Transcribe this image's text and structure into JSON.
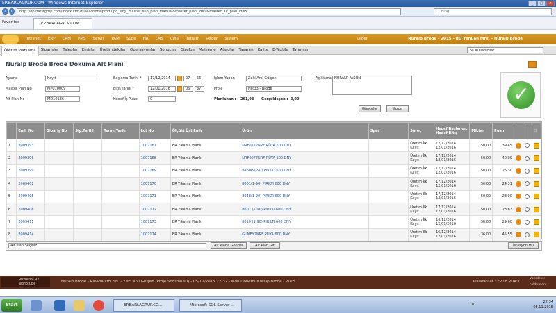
{
  "window": {
    "title": "EP.BARLAGRUP.COM - Windows Internet Explorer",
    "tab": "EP.BARLAGRUP.COM",
    "favorites": "Favorites"
  },
  "address": {
    "url": "http://ep.barlagrup.com/index.cfm?fuseaction=prod.upd_ezgi_master_sub_plan_manual&master_plan_id=9&master_alt_plan_id=5...",
    "search": "Bing"
  },
  "topmenu": {
    "items": [
      "Intranet",
      "ERP",
      "CRM",
      "PMS",
      "Servis",
      "PAM",
      "Şube",
      "HR",
      "LMS",
      "CMS",
      "İletişim",
      "Rapor",
      "Sistem"
    ],
    "other": "Diğer",
    "user": "Nuralp Brode - 2015 - BG Yenuan Mrk. - Nuralp Brode"
  },
  "submenu": {
    "items": [
      "Üretim Planlama",
      "Siparişler",
      "Talepler",
      "Emirler",
      "Üretimdekiler",
      "Operasyonlar",
      "Sonuçlar",
      "Çizelge",
      "Malzeme",
      "Ağaçlar",
      "Tasarım",
      "Kalite",
      "E-Textile",
      "Tanımlar"
    ],
    "select": "5K Kullanıcılar"
  },
  "page": {
    "title": "Nuralp Brode Brode Dokuma Alt Planı"
  },
  "form": {
    "asama_label": "Aşama",
    "asama_value": "Kayıt",
    "master_label": "Master Plan No",
    "master_value": "MP010009",
    "alt_label": "Alt Plan No",
    "alt_value": "MD10136",
    "bas_label": "Başlama Tarihi *",
    "bas_value": "17/12/2014",
    "bas_h": "07",
    "bas_m": "56",
    "bitis_label": "Bitiş Tarihi *",
    "bitis_value": "12/01/2016",
    "bitis_h": "06",
    "bitis_m": "37",
    "hedef_label": "Hedef İş Puanı",
    "hedef_value": "0",
    "islem_label": "İşlem Yapan",
    "islem_value": "Zeki Anıl Gülşen",
    "proje_label": "Proje",
    "proje_value": "No:33 - Brode",
    "planlanan_label": "Planlanan :",
    "planlanan_value": "261,93",
    "gerceklesen_label": "Gerçekleşen :",
    "gerceklesen_value": "0,00",
    "aciklama_label": "Açıklama",
    "aciklama_value": "NURALP FASON",
    "guncelle": "Güncelle",
    "yazdir": "Yazdır"
  },
  "table": {
    "headers": [
      "Emir No",
      "Sipariş No",
      "Sip.Tarihi",
      "Termı.Tarihi",
      "Lot No",
      "Ölçülü Üst Emir",
      "Ürün",
      "Spec",
      "Süreç",
      "Hedef Başlangıç Hedef Bitiş",
      "Miktar",
      "Puan"
    ],
    "rows": [
      {
        "n": "1",
        "emir": "2009393",
        "lot": "1007167",
        "ust": "BR Yıkama Planlı",
        "urun": "NRF0172NRF RÜYA 600 DNY",
        "surec1": "Üretim İlk",
        "surec2": "Kayıt",
        "t1": "17/12/2014",
        "t2": "12/01/2016",
        "miktar": "50,00",
        "puan": "39,45"
      },
      {
        "n": "2",
        "emir": "2009396",
        "lot": "1007168",
        "ust": "BR Yıkama Planlı",
        "urun": "NRF0077NRF RÜYA 600 DNY",
        "surec1": "Üretim İlk",
        "surec2": "Kayıt",
        "t1": "17/12/2014",
        "t2": "12/01/2016",
        "miktar": "50,00",
        "puan": "40,09"
      },
      {
        "n": "3",
        "emir": "2009399",
        "lot": "1007169",
        "ust": "BR Yıkama Planlı",
        "urun": "8460(9(-90) PIRILTI 600 DNY",
        "surec1": "Üretim İlk",
        "surec2": "Kayıt",
        "t1": "17/12/2014",
        "t2": "12/01/2016",
        "miktar": "50,00",
        "puan": "26,30"
      },
      {
        "n": "4",
        "emir": "2009402",
        "lot": "1007170",
        "ust": "BR Yıkama Planlı",
        "urun": "8001(1-90) PIRILTI 600 DNY",
        "surec1": "Üretim İlk",
        "surec2": "Kayıt",
        "t1": "17/12/2014",
        "t2": "12/01/2016",
        "miktar": "50,00",
        "puan": "24,31"
      },
      {
        "n": "5",
        "emir": "2009405",
        "lot": "1007171",
        "ust": "BR Yıkama Planlı",
        "urun": "8048(1-90) PIRILTI 600 DNY",
        "surec1": "Üretim İlk",
        "surec2": "Kayıt",
        "t1": "17/12/2014",
        "t2": "12/01/2016",
        "miktar": "50,00",
        "puan": "28,00"
      },
      {
        "n": "6",
        "emir": "2009408",
        "lot": "1007172",
        "ust": "BR Yıkama Planlı",
        "urun": "8607 (1-90) PIRILTI 600 DNY",
        "surec1": "Üretim İlk",
        "surec2": "Kayıt",
        "t1": "17/12/2014",
        "t2": "12/01/2016",
        "miktar": "50,00",
        "puan": "28,63"
      },
      {
        "n": "7",
        "emir": "2009411",
        "lot": "1007173",
        "ust": "BR Yıkama Planlı",
        "urun": "8010 (1-90) PIRILTI 600 DNY",
        "surec1": "Üretim İlk",
        "surec2": "Kayıt",
        "t1": "16/12/2014",
        "t2": "12/01/2016",
        "miktar": "50,00",
        "puan": "29,60"
      },
      {
        "n": "8",
        "emir": "2009414",
        "lot": "1007174",
        "ust": "BR Yıkama Planlı",
        "urun": "GUNEY2NRF RÜYA 600 DNY",
        "surec1": "Üretim İlk",
        "surec2": "Kayıt",
        "t1": "16/12/2014",
        "t2": "12/01/2016",
        "miktar": "36,00",
        "puan": "45,55"
      }
    ],
    "footer_select": "Alt Plan Seçiniz",
    "btn_send": "Alt Plana Gönder",
    "btn_remove": "Alt Plan Git",
    "btn_station": "İstasyon M.I"
  },
  "footer": {
    "powered": "powered by workcube",
    "text": "Nuralp Brode - Ribana Ltd. Stı. - Zeki Anıl Gülşen (Proje Sorumlusu) - 05/11/2015 22:32 - Muh.Dönemi:Nuralp Brode - 2015",
    "users": "Kullanıcılar : EP.18.PDA:1",
    "vars": "Variables: coldfusion"
  },
  "taskbar": {
    "start": "Start",
    "app1": "EP.BARLAGRUP.CO...",
    "app2": "Microsoft SQL Server ...",
    "lang": "TR",
    "time": "22:34",
    "date": "05.11.2015"
  }
}
